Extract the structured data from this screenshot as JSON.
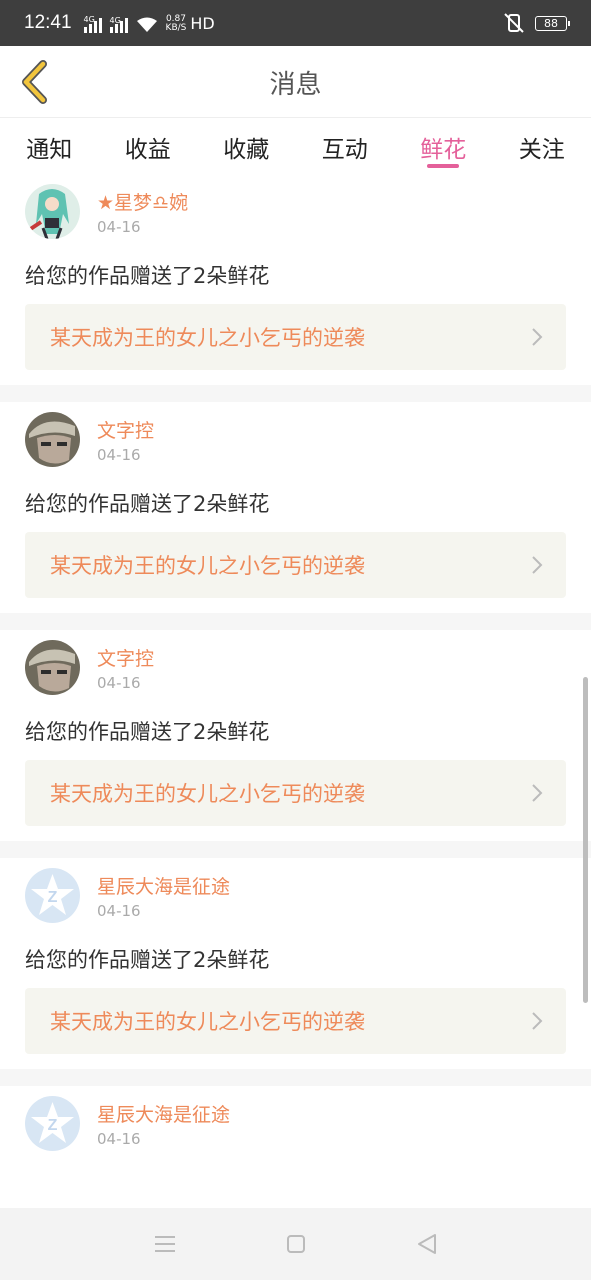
{
  "status": {
    "time": "12:41",
    "sig1": "4G",
    "sig2": "4G",
    "net_speed": "0.87",
    "net_unit": "KB/S",
    "hd": "HD",
    "battery": "88"
  },
  "header": {
    "title": "消息"
  },
  "tabs": [
    {
      "label": "通知",
      "active": false
    },
    {
      "label": "收益",
      "active": false
    },
    {
      "label": "收藏",
      "active": false
    },
    {
      "label": "互动",
      "active": false
    },
    {
      "label": "鲜花",
      "active": true
    },
    {
      "label": "关注",
      "active": false
    }
  ],
  "items": [
    {
      "user": "★星梦♎婉",
      "date": "04-16",
      "message": "给您的作品赠送了2朵鲜花",
      "work": "某天成为王的女儿之小乞丐的逆袭",
      "avatar": "anime-avatar"
    },
    {
      "user": "文字控",
      "date": "04-16",
      "message": "给您的作品赠送了2朵鲜花",
      "work": "某天成为王的女儿之小乞丐的逆袭",
      "avatar": "man-hat-avatar"
    },
    {
      "user": "文字控",
      "date": "04-16",
      "message": "给您的作品赠送了2朵鲜花",
      "work": "某天成为王的女儿之小乞丐的逆袭",
      "avatar": "man-hat-avatar"
    },
    {
      "user": "星辰大海是征途",
      "date": "04-16",
      "message": "给您的作品赠送了2朵鲜花",
      "work": "某天成为王的女儿之小乞丐的逆袭",
      "avatar": "default-avatar"
    },
    {
      "user": "星辰大海是征途",
      "date": "04-16",
      "message": "",
      "work": "",
      "avatar": "default-avatar"
    }
  ],
  "colors": {
    "accent": "#e4609a",
    "name": "#ee8a5a",
    "back_arrow": "#f2c53d"
  }
}
